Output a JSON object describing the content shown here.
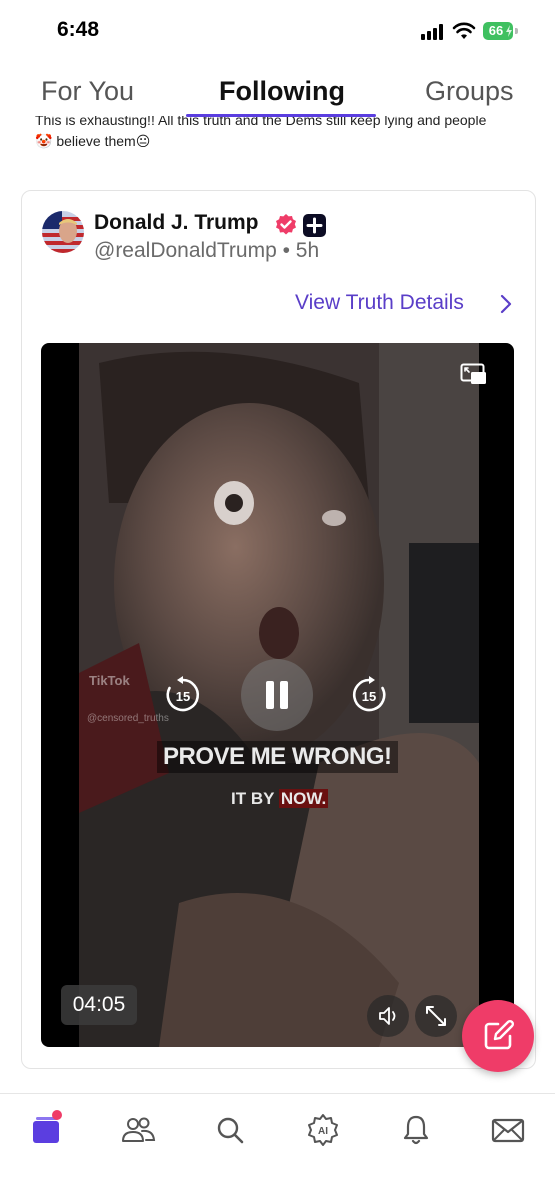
{
  "status_bar": {
    "time": "6:48",
    "battery": "66"
  },
  "tabs": [
    {
      "label": "For You",
      "active": false
    },
    {
      "label": "Following",
      "active": true
    },
    {
      "label": "Groups",
      "active": false
    }
  ],
  "previous_post": {
    "line1": "This is exhausting!! All this truth and the Dems still keep lying and people",
    "line2": "🤡 believe them😐"
  },
  "post": {
    "author_name": "Donald J. Trump",
    "handle_time": "@realDonaldTrump • 5h",
    "view_details": "View Truth Details",
    "video": {
      "skip_back": "15",
      "skip_forward": "15",
      "duration": "04:05",
      "caption_main": "PROVE ME WRONG!",
      "caption_sub_a": "IT BY ",
      "caption_sub_b": "NOW.",
      "watermark_brand": "TikTok",
      "watermark_user": "@censored_truths"
    }
  },
  "bottom_nav": [
    {
      "icon": "feed-icon",
      "active": true
    },
    {
      "icon": "people-icon",
      "active": false
    },
    {
      "icon": "search-icon",
      "active": false
    },
    {
      "icon": "ai-icon",
      "active": false
    },
    {
      "icon": "bell-icon",
      "active": false
    },
    {
      "icon": "mail-icon",
      "active": false
    }
  ],
  "colors": {
    "accent": "#5b3ee0",
    "link": "#5a3ec8",
    "fab": "#ef3c68",
    "battery": "#3fc060"
  }
}
